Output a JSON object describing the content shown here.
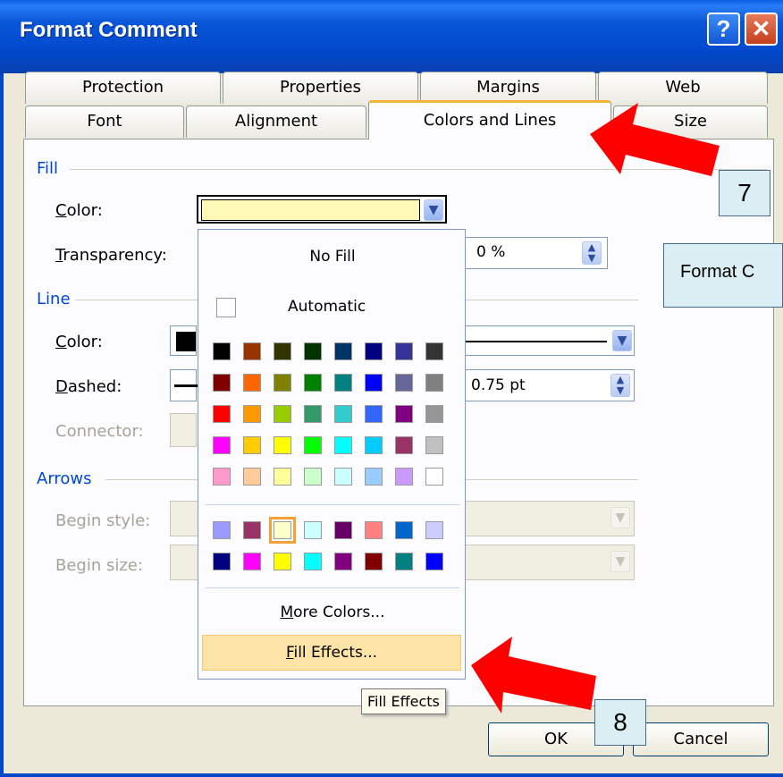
{
  "window": {
    "title": "Format Comment",
    "help_glyph": "?",
    "close_glyph": "✕"
  },
  "tabs": {
    "row_back": [
      "Protection",
      "Properties",
      "Margins",
      "Web"
    ],
    "row_front": [
      "Font",
      "Alignment",
      "Colors and Lines",
      "Size"
    ],
    "active": "Colors and Lines"
  },
  "fill": {
    "group_label": "Fill",
    "color_label": "Color:",
    "transparency_label": "Transparency:",
    "transparency_value": "0 %",
    "color_value": "#fff9b8"
  },
  "line": {
    "group_label": "Line",
    "color_label": "Color:",
    "dashed_label": "Dashed:",
    "connector_label": "Connector:",
    "weight_value": "0.75 pt"
  },
  "arrows": {
    "group_label": "Arrows",
    "begin_style_label": "Begin style:",
    "begin_size_label": "Begin size:"
  },
  "palette": {
    "no_fill": "No Fill",
    "automatic": "Automatic",
    "more_colors": "More Colors...",
    "fill_effects": "Fill Effects...",
    "main_colors": [
      [
        "#000000",
        "#993300",
        "#333300",
        "#003300",
        "#003366",
        "#000080",
        "#333399",
        "#333333"
      ],
      [
        "#800000",
        "#ff6600",
        "#808000",
        "#008000",
        "#008080",
        "#0000ff",
        "#666699",
        "#808080"
      ],
      [
        "#ff0000",
        "#ff9900",
        "#99cc00",
        "#339966",
        "#33cccc",
        "#3366ff",
        "#800080",
        "#969696"
      ],
      [
        "#ff00ff",
        "#ffcc00",
        "#ffff00",
        "#00ff00",
        "#00ffff",
        "#00ccff",
        "#993366",
        "#c0c0c0"
      ],
      [
        "#ff99cc",
        "#ffcc99",
        "#ffff99",
        "#ccffcc",
        "#ccffff",
        "#99ccff",
        "#cc99ff",
        "#ffffff"
      ]
    ],
    "chart_colors": [
      [
        "#9999ff",
        "#993366",
        "#ffffcc",
        "#ccffff",
        "#660066",
        "#ff8080",
        "#0066cc",
        "#ccccff"
      ],
      [
        "#000080",
        "#ff00ff",
        "#ffff00",
        "#00ffff",
        "#800080",
        "#800000",
        "#008080",
        "#0000ff"
      ]
    ],
    "selected": "#ffffcc"
  },
  "tooltip": "Fill Effects",
  "callouts": {
    "step7": "7",
    "step8": "8",
    "side_note": "Format C"
  },
  "buttons": {
    "ok": "OK",
    "cancel": "Cancel"
  },
  "colors": {
    "accent_arrow": "#ff0000",
    "title_bar": "#0a56d8",
    "menu_highlight": "#ffe4a8"
  }
}
